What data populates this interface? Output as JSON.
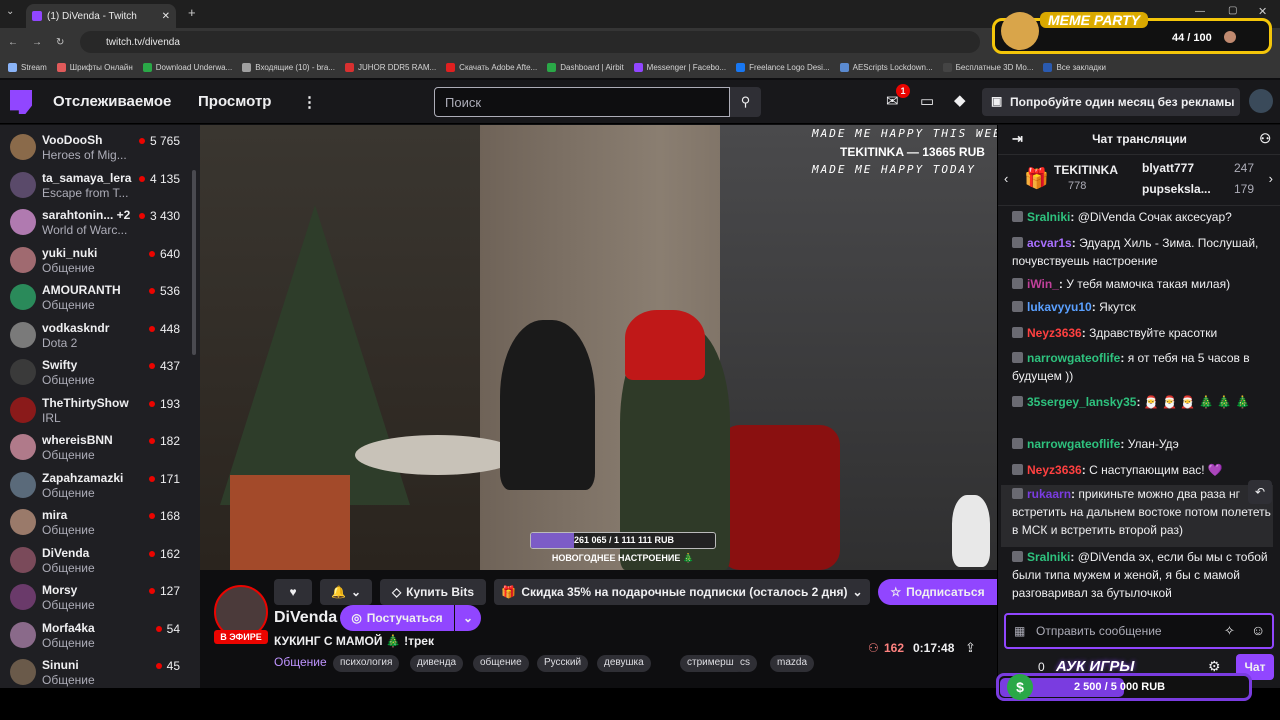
{
  "browser": {
    "tab_title": "(1) DiVenda - Twitch",
    "url": "twitch.tv/divenda",
    "bookmarks": [
      "Stream",
      "Шрифты Онлайн",
      "Download Underwa...",
      "Входящие (10) - bra...",
      "JUHOR DDR5 RAM...",
      "Скачать Adobe Afte...",
      "Dashboard | Airbit",
      "Messenger | Facebo...",
      "Freelance Logo Desi...",
      "AEScripts Lockdown...",
      "Бесплатные 3D Мо...",
      "Все закладки"
    ]
  },
  "nav": {
    "following": "Отслеживаемое",
    "browse": "Просмотр",
    "search_placeholder": "Поиск",
    "notif_count": "1",
    "promo": "Попробуйте один месяц без рекламы"
  },
  "sidebar": {
    "channels": [
      {
        "name": "VooDooSh",
        "game": "Heroes of Mig...",
        "viewers": "5 765",
        "color": "#8a6a4a"
      },
      {
        "name": "ta_samaya_lera",
        "game": "Escape from T...",
        "viewers": "4 135",
        "color": "#5a4a6a"
      },
      {
        "name": "sarahtonin... +2",
        "game": "World of Warc...",
        "viewers": "3 430",
        "color": "#b07ab0"
      },
      {
        "name": "yuki_nuki",
        "game": "Общение",
        "viewers": "640",
        "color": "#a06a70"
      },
      {
        "name": "AMOURANTH",
        "game": "Общение",
        "viewers": "536",
        "color": "#2a8a5a"
      },
      {
        "name": "vodkaskndr",
        "game": "Dota 2",
        "viewers": "448",
        "color": "#7a7a7a"
      },
      {
        "name": "Swifty",
        "game": "Общение",
        "viewers": "437",
        "color": "#3a3a3a"
      },
      {
        "name": "TheThirtyShow",
        "game": "IRL",
        "viewers": "193",
        "color": "#8a1a1a"
      },
      {
        "name": "whereisBNN",
        "game": "Общение",
        "viewers": "182",
        "color": "#b07a8a"
      },
      {
        "name": "Zapahzamazki",
        "game": "Общение",
        "viewers": "171",
        "color": "#5a6a7a"
      },
      {
        "name": "mira",
        "game": "Общение",
        "viewers": "168",
        "color": "#9a7a6a"
      },
      {
        "name": "DiVenda",
        "game": "Общение",
        "viewers": "162",
        "color": "#7a4a5a"
      },
      {
        "name": "Morsy",
        "game": "Общение",
        "viewers": "127",
        "color": "#6a3a6a"
      },
      {
        "name": "Morfa4ka",
        "game": "Общение",
        "viewers": "54",
        "color": "#8a6a8a"
      },
      {
        "name": "Sinuni",
        "game": "Общение",
        "viewers": "45",
        "color": "#6a5a4a"
      }
    ]
  },
  "video": {
    "overlay_line1": "MADE ME HAPPY THIS WEEK",
    "overlay_line2": "MADE ME HAPPY TODAY",
    "donor": "TEKITINKA — 13665 RUB",
    "goal_text": "261 065 / 1 111 111 RUB",
    "goal_fraction": 0.235,
    "goal_title": "НОВОГОДНЕЕ НАСТРОЕНИЕ 🎄"
  },
  "stream": {
    "live_badge": "В ЭФИРЕ",
    "channel": "DiVenda",
    "title": "КУКИНГ С МАМОЙ 🎄 !трек",
    "category": "Общение",
    "tags": [
      "психология",
      "дивенда",
      "общение",
      "Русский",
      "девушка",
      "стримерша",
      "cs",
      "mazda"
    ],
    "viewers": "162",
    "uptime": "0:17:48",
    "buy_bits": "Купить Bits",
    "sub_promo": "Скидка 35% на подарочные подписки (осталось 2 дня)",
    "subscribe": "Подписаться",
    "hype": "Постучаться"
  },
  "chat": {
    "header": "Чат трансляции",
    "gifters": [
      {
        "name": "TEKITINKA",
        "count": "778"
      },
      {
        "name": "blyatt777",
        "count": "247"
      },
      {
        "name": "pupseksla...",
        "count": "179"
      }
    ],
    "messages": [
      {
        "user": "Sralniki",
        "color": "#2ec27e",
        "text": "@DiVenda Сочак аксесуар?"
      },
      {
        "user": "acvar1s",
        "color": "#a970ff",
        "text": "Эдуард Хиль - Зима. Послушай, почувствуешь настроение"
      },
      {
        "user": "iWin_",
        "color": "#c0409a",
        "text": "У тебя мамочка такая милая)"
      },
      {
        "user": "lukavyyu10",
        "color": "#5aa0ff",
        "text": "Якутск"
      },
      {
        "user": "Neyz3636",
        "color": "#ff4040",
        "text": "Здравствуйте красотки"
      },
      {
        "user": "narrowgateoflife",
        "color": "#2ec27e",
        "text": "я от тебя на 5 часов в будущем ))"
      },
      {
        "user": "35sergey_lansky35",
        "color": "#2ec27e",
        "text": "🎅 🎅 🎅 🎄 🎄 🎄"
      },
      {
        "user": "narrowgateoflife",
        "color": "#2ec27e",
        "text": "Улан-Удэ"
      },
      {
        "user": "Neyz3636",
        "color": "#ff4040",
        "text": "С наступающим вас! 💜"
      },
      {
        "user": "rukaarn",
        "color": "#7a3ce0",
        "text": "прикиньте можно два раза нг встретить на дальнем востоке потом полететь в МСК и встретить второй раз)"
      },
      {
        "user": "Sralniki",
        "color": "#2ec27e",
        "text": "@DiVenda эх, если бы мы с тобой были типа мужем и женой, я бы с мамой разговаривал за бутылочкой"
      }
    ],
    "input_placeholder": "Отправить сообщение",
    "points": "0",
    "send": "Чат"
  },
  "widgets": {
    "meme_title": "MEME PARTY",
    "meme_count": "44 / 100",
    "meme_fraction": 0.44,
    "auk_title": "АУК ИГРЫ",
    "auk_value": "2 500 / 5 000 RUB",
    "auk_fraction": 0.5
  }
}
